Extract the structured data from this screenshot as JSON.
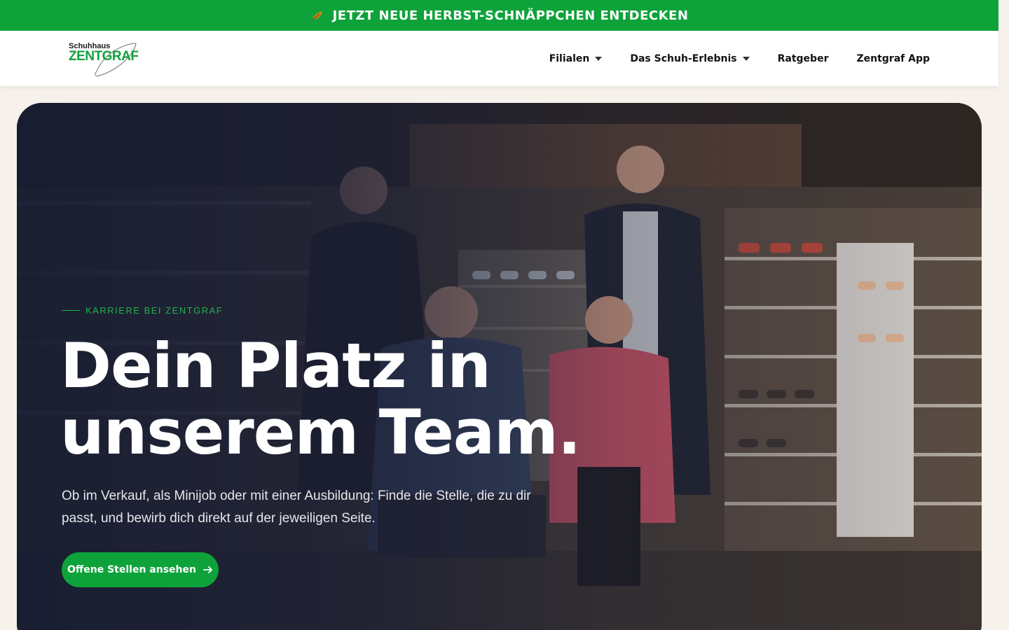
{
  "promo": {
    "text": "JETZT NEUE HERBST-SCHNÄPPCHEN ENTDECKEN",
    "icon": "leaf-icon"
  },
  "header": {
    "logo": {
      "small": "Schuhhaus",
      "big": "ZENTGRAF"
    },
    "nav": [
      {
        "label": "Filialen",
        "has_dropdown": true
      },
      {
        "label": "Das Schuh-Erlebnis",
        "has_dropdown": true
      },
      {
        "label": "Ratgeber",
        "has_dropdown": false
      },
      {
        "label": "Zentgraf App",
        "has_dropdown": false
      }
    ]
  },
  "hero": {
    "eyebrow": "KARRIERE BEI ZENTGRAF",
    "title_line1": "Dein Platz in",
    "title_line2": "unserem Team.",
    "subtitle": "Ob im Verkauf, als Minijob oder mit einer Ausbildung: Finde die Stelle, die zu dir passt, und bewirb dich direkt auf der jeweiligen Seite.",
    "cta_label": "Offene Stellen ansehen",
    "cta_icon": "arrow-right-icon"
  },
  "colors": {
    "brand_green": "#0ea33a",
    "page_bg": "#f6f1ea",
    "hero_overlay": "#161c32"
  }
}
